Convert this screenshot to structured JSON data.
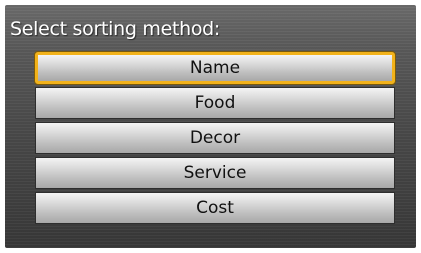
{
  "screen": {
    "prompt": "Select sorting method:"
  },
  "sort_options": [
    {
      "label": "Name",
      "selected": true
    },
    {
      "label": "Food",
      "selected": false
    },
    {
      "label": "Decor",
      "selected": false
    },
    {
      "label": "Service",
      "selected": false
    },
    {
      "label": "Cost",
      "selected": false
    }
  ],
  "colors": {
    "highlight": "#f2b21a",
    "background": "#4a4a4a"
  }
}
